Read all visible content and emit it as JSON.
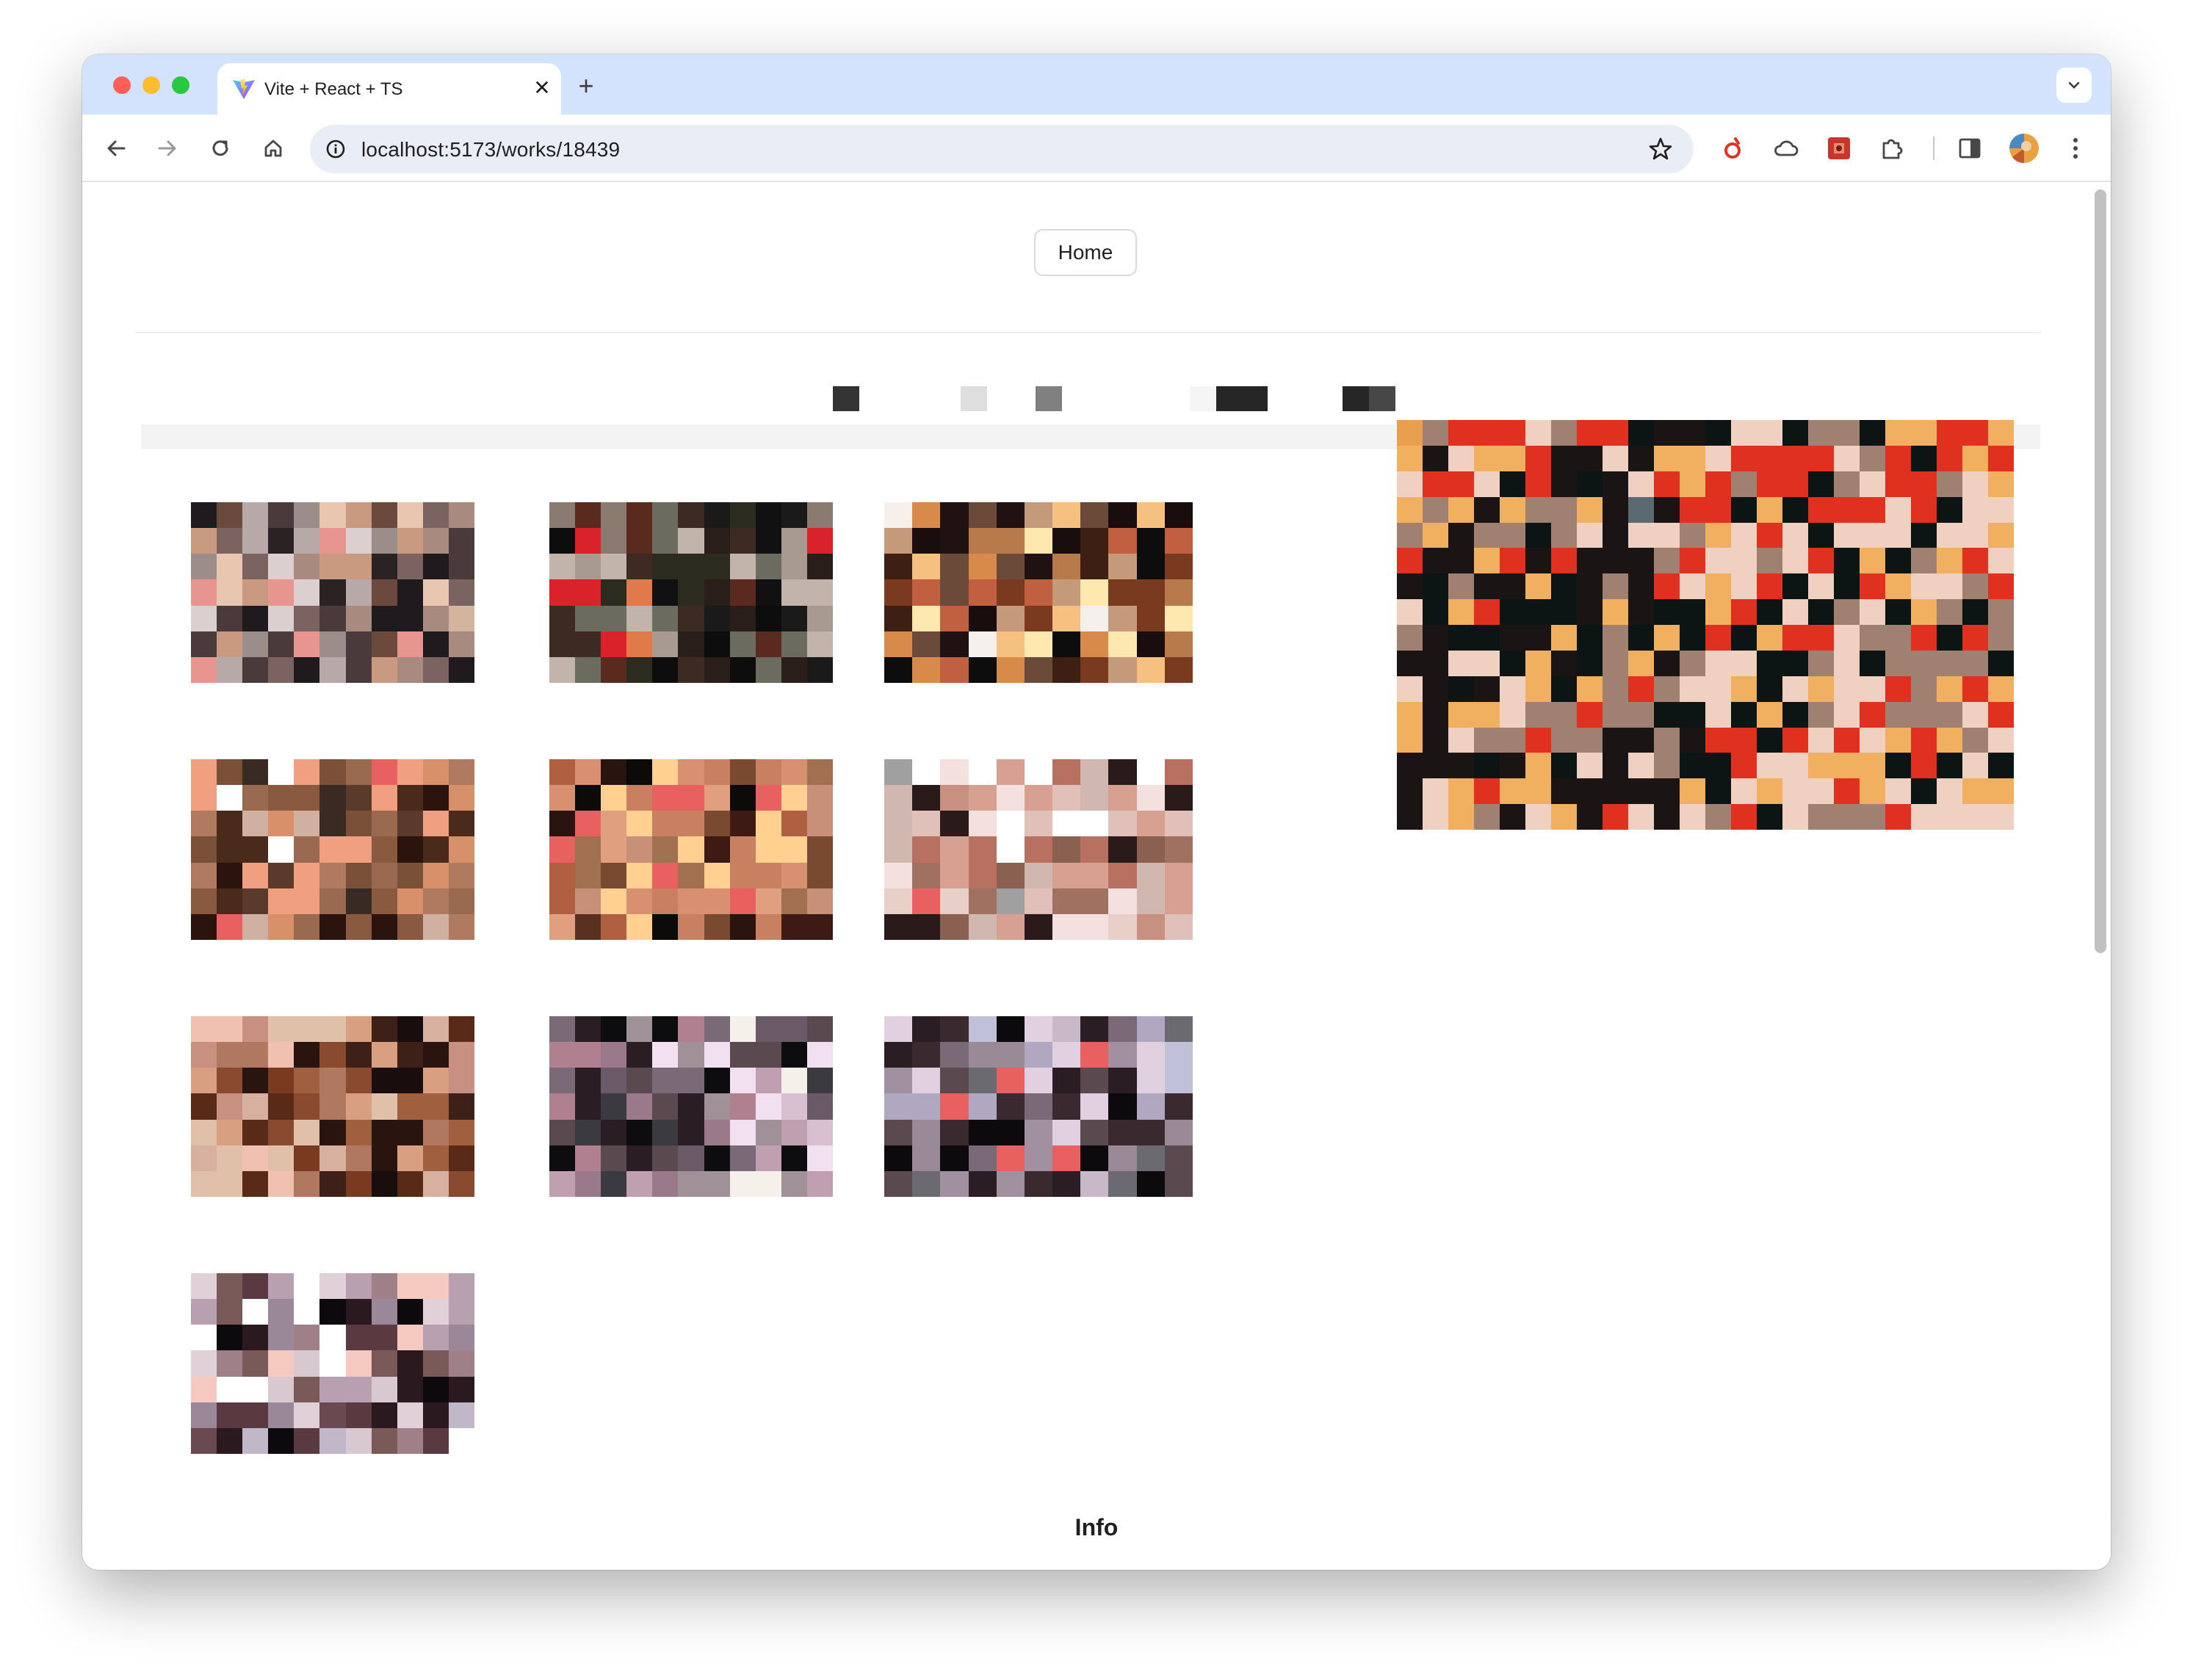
{
  "browser": {
    "tab_title": "Vite + React + TS",
    "tab_favicon": "vite-logo-icon",
    "url": "localhost:5173/works/18439",
    "toolbar_icons": [
      "back-icon",
      "forward-icon",
      "reload-icon",
      "home-icon",
      "site-info-icon",
      "bookmark-star-icon"
    ],
    "extensions": [
      "red-circle-extension-icon",
      "cloud-extension-icon",
      "red-puzzle-extension-icon",
      "puzzle-extension-icon",
      "side-panel-icon",
      "profile-avatar",
      "menu-kebab-icon"
    ]
  },
  "nav": {
    "home_label": "Home"
  },
  "title_blocks": [
    {
      "color": "#333333"
    },
    {
      "color": "#dedede"
    },
    {
      "color": "#808080"
    },
    {
      "color": "#f5f5f5"
    },
    {
      "color": "#262626"
    },
    {
      "color": "#262626"
    },
    {
      "color": "#474747"
    }
  ],
  "gallery": {
    "thumbnails": [
      {
        "palette": [
          "#e8958f",
          "#dccfcf",
          "#e8c6b0",
          "#c99a80",
          "#6b4a3d",
          "#b7a9a7",
          "#2b2223",
          "#4a3a3b",
          "#a88a7f",
          "#d3b59e",
          "#1f1a1d",
          "#7a6360",
          "#9a8d8a"
        ]
      },
      {
        "palette": [
          "#d9222a",
          "#2b2b1f",
          "#111111",
          "#a89a90",
          "#c2b4aa",
          "#5a2a1f",
          "#3d2a22",
          "#0d0d0d",
          "#6b6b60",
          "#e07a4a",
          "#1a1a1a",
          "#2a1e1a",
          "#8a7a70"
        ]
      },
      {
        "palette": [
          "#c49a7a",
          "#f5f0ec",
          "#6b4a3a",
          "#201212",
          "#1a0d0d",
          "#b87a4a",
          "#d88a4a",
          "#ffe8b0",
          "#c06040",
          "#3d1f14",
          "#f5c080",
          "#0d0d0d",
          "#7a3a20"
        ]
      },
      {
        "palette": [
          "#e86060",
          "#9a6a50",
          "#7a5038",
          "#2a140d",
          "#d8906a",
          "#f0a080",
          "#4a2a1a",
          "#b07a60",
          "#3a2a24",
          "#d0b0a0",
          "#ffffff",
          "#8a5a40",
          "#5a3a2a"
        ]
      },
      {
        "palette": [
          "#e86060",
          "#c89078",
          "#2a1410",
          "#5a3020",
          "#d89070",
          "#ffd090",
          "#3d1a14",
          "#b06040",
          "#a07050",
          "#0d0a0a",
          "#c88060",
          "#7a4a30",
          "#e0a080"
        ]
      },
      {
        "palette": [
          "#e86060",
          "#a07060",
          "#2a1a1a",
          "#d0b8b0",
          "#c89080",
          "#ffffff",
          "#e0c0b8",
          "#b87060",
          "#f5e0e0",
          "#a0a0a0",
          "#d8a090",
          "#e8d0c8",
          "#8a6050"
        ]
      },
      {
        "palette": [
          "#f0c0b0",
          "#d8a080",
          "#1a0d0d",
          "#b07860",
          "#2a1410",
          "#a06040",
          "#d8b0a0",
          "#7a3a20",
          "#3d2018",
          "#c89080",
          "#e0c0a8",
          "#8a4a30",
          "#5a2a18"
        ]
      },
      {
        "palette": [
          "#f5f0ea",
          "#3a3a40",
          "#7a6a78",
          "#2a1e24",
          "#9a7a8a",
          "#c0a0b0",
          "#f0e0f0",
          "#0d0d10",
          "#5a4a50",
          "#b08090",
          "#d8c0d0",
          "#6a5a68",
          "#a09098"
        ]
      },
      {
        "palette": [
          "#6a6a70",
          "#e86060",
          "#2a1e24",
          "#9a8a98",
          "#e0d0e0",
          "#c0c0d8",
          "#5a4a50",
          "#a090a0",
          "#7a6a78",
          "#0d0a0d",
          "#b0a8c0",
          "#3a2a30",
          "#c8b8c8"
        ]
      },
      {
        "palette": [
          "#f5c8c0",
          "#7a5a58",
          "#ffffff",
          "#c0b8c8",
          "#5a3a40",
          "#a08088",
          "#e0d0d8",
          "#2a1a20",
          "#b8a0b0",
          "#0d0a0d",
          "#9a8898",
          "#d8c8d0",
          "#6a4a50"
        ]
      }
    ]
  },
  "preview": {
    "palette": [
      "#a08070",
      "#1a1414",
      "#d06030",
      "#f5f0ec",
      "#0d1414",
      "#6a4a38",
      "#d8a070",
      "#c09070",
      "#f0b060",
      "#3a2a24",
      "#e0c0a0",
      "#101818",
      "#e03020",
      "#4a5a40",
      "#8ab0d8",
      "#b07050",
      "#f0d0c0",
      "#5a6a70",
      "#2a1e1a",
      "#e8a050"
    ]
  },
  "info": {
    "heading": "Info"
  }
}
